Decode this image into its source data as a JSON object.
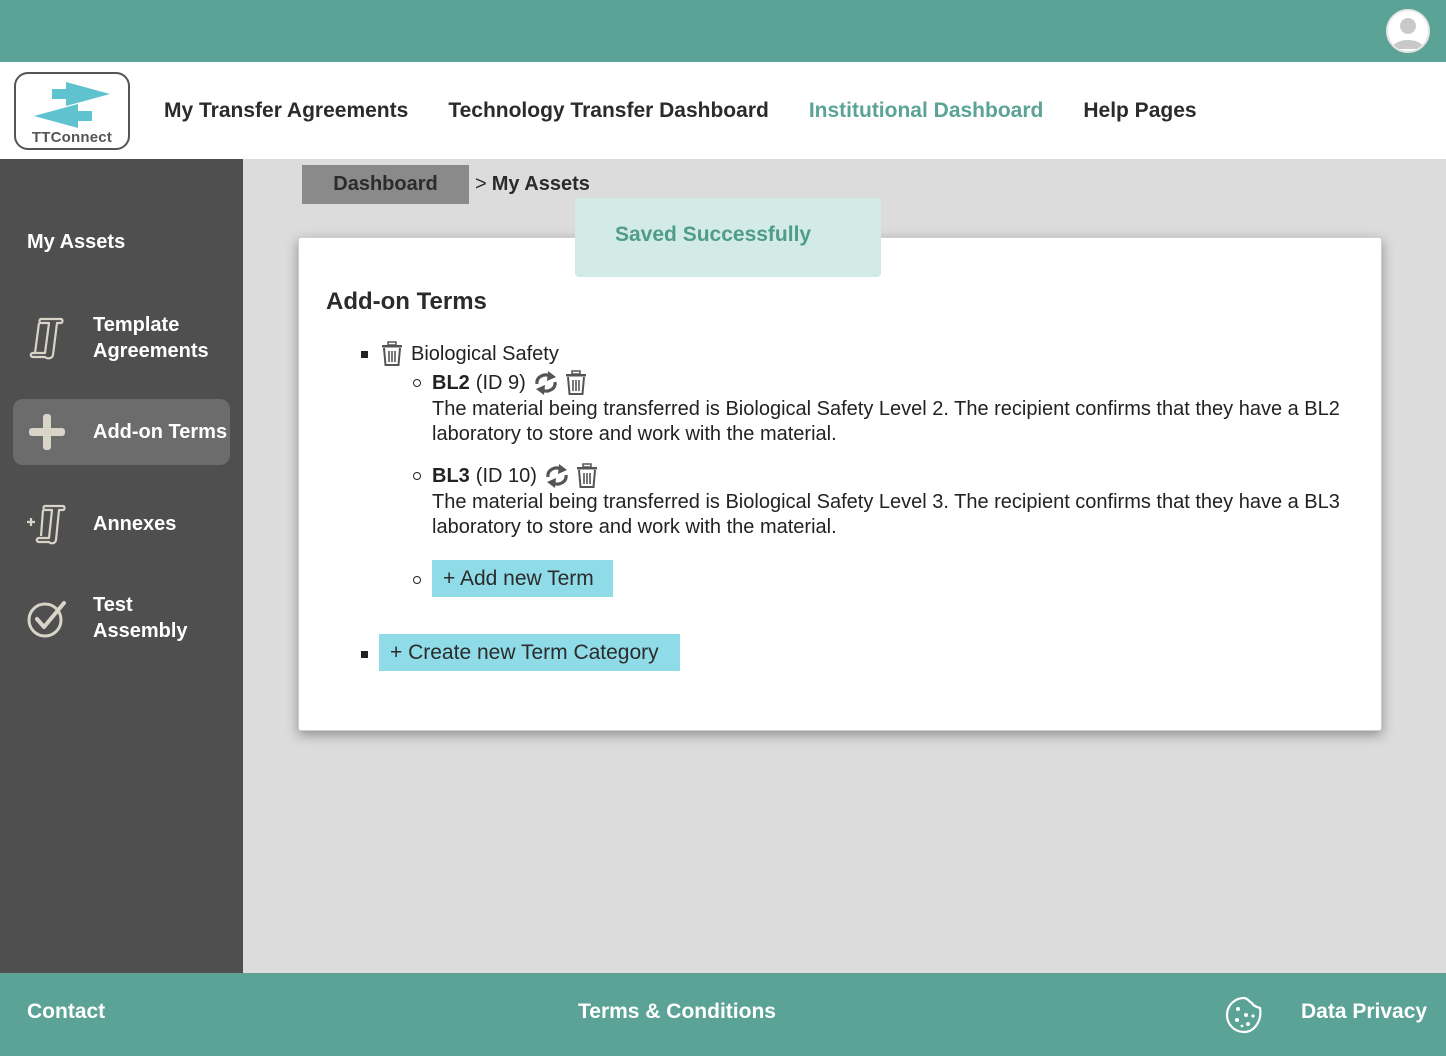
{
  "header": {
    "avatar_icon": "user-avatar-icon"
  },
  "brand": {
    "logo_text": "TTConnect",
    "logo_icon": "bidirectional-arrow-icon",
    "accent": "#5ba396",
    "arrow_color": "#5ec3cf"
  },
  "nav": {
    "links": [
      {
        "label": "My Transfer Agreements",
        "active": false
      },
      {
        "label": "Technology Transfer Dashboard",
        "active": false
      },
      {
        "label": "Institutional Dashboard",
        "active": true
      },
      {
        "label": "Help Pages",
        "active": false
      }
    ]
  },
  "sidebar": {
    "title": "My Assets",
    "items": [
      {
        "label": "Template Agreements",
        "icon": "scroll-icon",
        "active": false
      },
      {
        "label": "Add-on Terms",
        "icon": "plus-icon",
        "active": true
      },
      {
        "label": "Annexes",
        "icon": "scroll-plus-icon",
        "active": false
      },
      {
        "label": "Test Assembly",
        "icon": "checkmark-circle-icon",
        "active": false
      }
    ]
  },
  "breadcrumb": {
    "parent": "Dashboard",
    "separator": ">",
    "current": "My Assets"
  },
  "toast": {
    "message": "Saved Successfully",
    "bg_color": "#d3ebe6"
  },
  "main": {
    "title": "Add-on Terms",
    "categories": [
      {
        "name": "Biological Safety",
        "terms": [
          {
            "code": "BL2",
            "id_label": "(ID 9)",
            "description": "The material being transferred is Biological Safety Level 2. The recipient confirms that they have a BL2 laboratory to store and work with the material."
          },
          {
            "code": "BL3",
            "id_label": "(ID 10)",
            "description": "The material being transferred is Biological Safety Level 3. The recipient confirms that they have a BL3 laboratory to store and work with the material."
          }
        ],
        "add_term_label": "+ Add new Term"
      }
    ],
    "create_category_label": "+ Create new Term Category",
    "button_color": "#8fdbe8"
  },
  "footer": {
    "contact": "Contact",
    "terms": "Terms & Conditions",
    "privacy": "Data Privacy",
    "cookie_icon": "cookie-icon"
  }
}
